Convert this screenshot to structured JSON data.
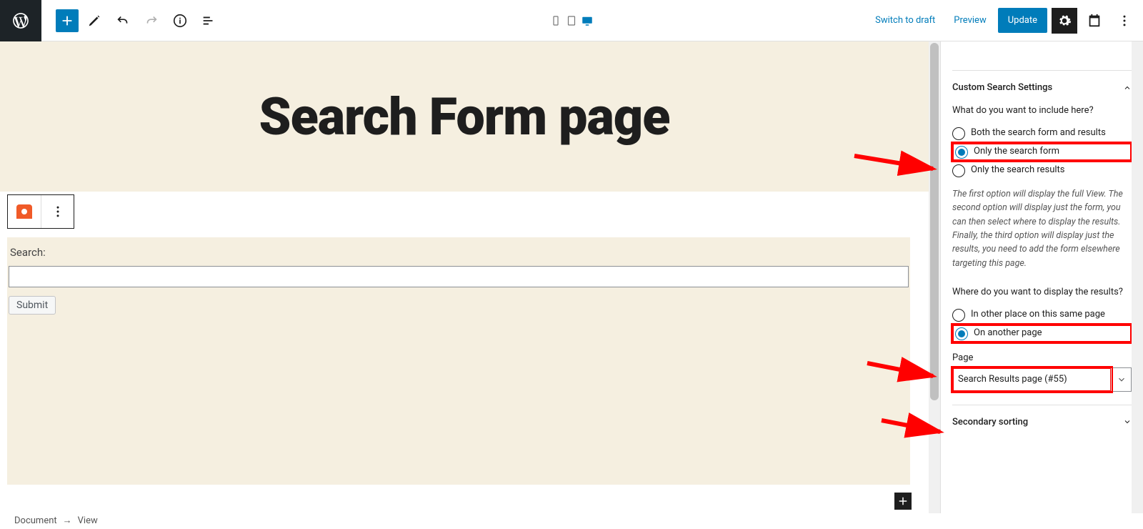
{
  "topbar": {
    "switch_to_draft": "Switch to draft",
    "preview": "Preview",
    "update": "Update"
  },
  "hero": {
    "title": "Search Form page"
  },
  "form": {
    "label": "Search:",
    "submit": "Submit"
  },
  "sidebar": {
    "panel1_title": "Custom Search Settings",
    "q1": "What do you want to include here?",
    "opt_both": "Both the search form and results",
    "opt_form": "Only the search form",
    "opt_results": "Only the search results",
    "help1": "The first option will display the full View. The second option will display just the form, you can then select where to display the results. Finally, the third option will display just the results, you need to add the form elsewhere targeting this page.",
    "q2": "Where do you want to display the results?",
    "opt_same": "In other place on this same page",
    "opt_other": "On another page",
    "page_label": "Page",
    "page_value": "Search Results page (#55)",
    "panel2_title": "Secondary sorting"
  },
  "breadcrumb": {
    "doc": "Document",
    "view": "View"
  }
}
